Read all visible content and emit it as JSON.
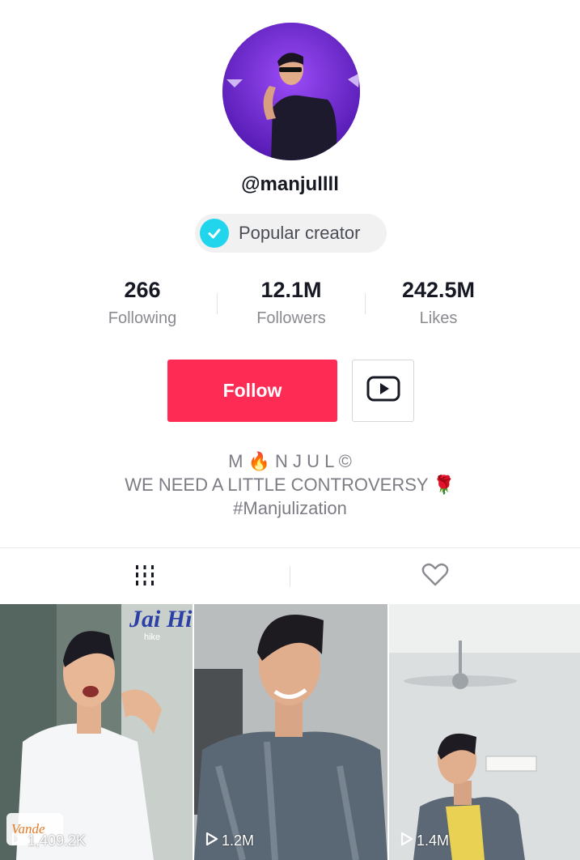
{
  "profile": {
    "username": "@manjullll",
    "badge_label": "Popular creator",
    "badge_icon": "verified-check-icon"
  },
  "stats": [
    {
      "value": "266",
      "label": "Following"
    },
    {
      "value": "12.1M",
      "label": "Followers"
    },
    {
      "value": "242.5M",
      "label": "Likes"
    }
  ],
  "actions": {
    "follow_label": "Follow",
    "youtube_icon": "youtube-icon"
  },
  "bio": {
    "line1": "M 🔥 N J U L ©",
    "line2": "WE NEED A LITTLE CONTROVERSY 🌹",
    "line3": "#Manjulization"
  },
  "tabs": [
    {
      "icon": "videos-grid-icon"
    },
    {
      "icon": "liked-heart-icon"
    }
  ],
  "videos": [
    {
      "views": "1,409.2K",
      "overlay_text": "Jai Hind",
      "sub_text": "hike",
      "corner_text": "Vande"
    },
    {
      "views": "1.2M"
    },
    {
      "views": "1.4M"
    }
  ],
  "colors": {
    "accent": "#fe2c55",
    "badge_check": "#20d5ec",
    "avatar_bg": "#6a1fd6"
  }
}
